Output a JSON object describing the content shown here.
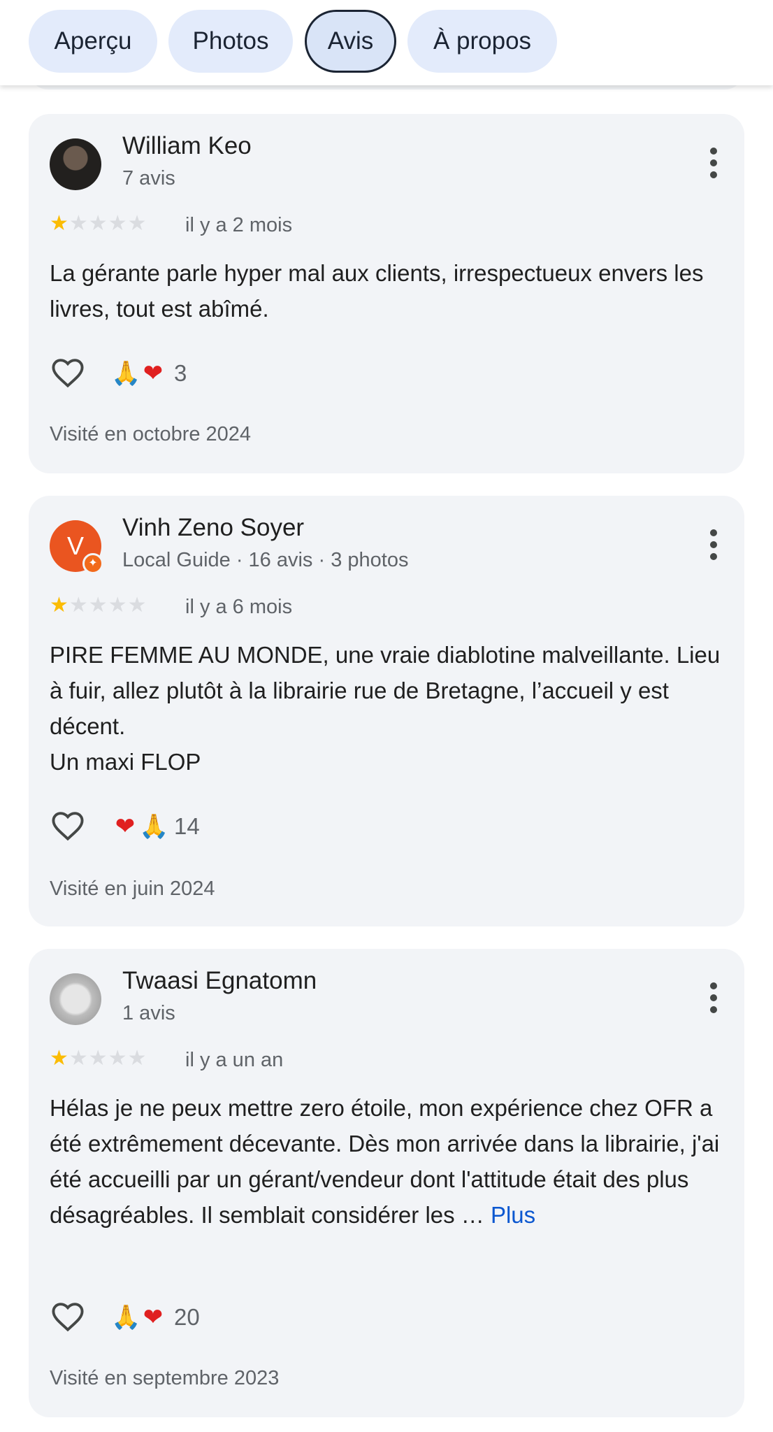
{
  "tabs": [
    {
      "label": "Aperçu",
      "active": false
    },
    {
      "label": "Photos",
      "active": false
    },
    {
      "label": "Avis",
      "active": true
    },
    {
      "label": "À propos",
      "active": false
    }
  ],
  "colors": {
    "star": "#fbbc04",
    "link": "#0b57d0",
    "card_background": "#f2f4f7",
    "avatar_letter_background": "#ea5520"
  },
  "reviews": [
    {
      "author": "William Keo",
      "meta": "7 avis",
      "rating": 1,
      "max_rating": 5,
      "date": "il y a 2 mois",
      "text": "La gérante parle hyper mal aux clients, irrespectueux envers les livres, tout est abîmé.",
      "more_link": "",
      "reactions": {
        "emojis": [
          "🙏",
          "❤"
        ],
        "count": "3"
      },
      "visited": "Visité en octobre 2024",
      "avatar": {
        "type": "photo"
      }
    },
    {
      "author": "Vinh Zeno Soyer",
      "meta": "Local Guide · 16 avis · 3 photos",
      "rating": 1,
      "max_rating": 5,
      "date": "il y a 6 mois",
      "text": "PIRE FEMME AU MONDE, une vraie diablotine malveillante. Lieu à fuir, allez plutôt à la librairie rue de Bretagne, l’accueil y est décent.\nUn maxi FLOP",
      "more_link": "",
      "reactions": {
        "emojis": [
          "❤",
          "🙏"
        ],
        "count": "14"
      },
      "visited": "Visité en juin 2024",
      "avatar": {
        "type": "letter",
        "letter": "V",
        "badge": "local-guide"
      }
    },
    {
      "author": "Twaasi Egnatomn",
      "meta": "1 avis",
      "rating": 1,
      "max_rating": 5,
      "date": "il y a un an",
      "text": "Hélas je ne peux mettre zero étoile, mon expérience chez OFR a été extrêmement décevante. Dès mon arrivée dans la librairie, j'ai été accueilli par un gérant/vendeur dont l'attitude était des plus désagréables. Il semblait considérer les … ",
      "more_link": "Plus",
      "reactions": {
        "emojis": [
          "🙏",
          "❤"
        ],
        "count": "20"
      },
      "visited": "Visité en septembre 2023",
      "avatar": {
        "type": "photo"
      }
    }
  ]
}
